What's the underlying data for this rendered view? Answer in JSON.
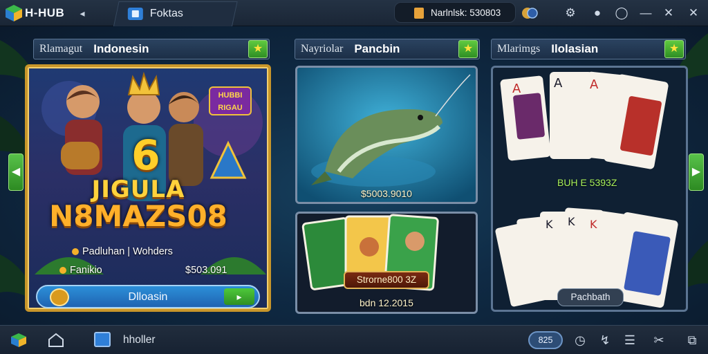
{
  "titlebar": {
    "app_title": "H-HUB",
    "tab_label": "Foktas",
    "coin_balance": "Narlnlsk: 530803",
    "icons": [
      "back-arrow-icon",
      "coin-icon",
      "avatar-badge-icon",
      "settings-gear-icon",
      "record-icon",
      "help-circle-icon",
      "minimize-icon",
      "restore-icon",
      "close-icon"
    ]
  },
  "panels": [
    {
      "small_label": "Rlamagut",
      "title": "Indonesin"
    },
    {
      "small_label": "Nayriolar",
      "title": "Pancbin"
    },
    {
      "small_label": "Mlarimgs",
      "title": "Ilolasian"
    }
  ],
  "left_card": {
    "big_number": "6",
    "line1": "JIGULA",
    "line2": "N8MAZS08",
    "tag": "HUBBI RIGAU",
    "row1": "Padluhan | Wohders",
    "row2_label": "Fanikio",
    "row2_value": "$503.091",
    "play_label": "Dlloasin"
  },
  "mid_top": {
    "prize": "$5003.9010"
  },
  "mid_bot": {
    "plate": "Strorne800 3Z",
    "caption": "bdn 12.2015"
  },
  "right_card": {
    "green_text": "BUH E 5393Z",
    "pill": "Pachbath"
  },
  "bottombar": {
    "label": "hholler",
    "pill": "825",
    "icons": [
      "app-logo-icon",
      "home-icon",
      "app-window-icon",
      "speedometer-icon",
      "share-icon",
      "list-icon",
      "scissors-icon",
      "fullscreen-icon"
    ]
  },
  "colors": {
    "accent_green": "#3fa92e",
    "gold": "#c8962a",
    "title_bg": "#1a2636"
  }
}
